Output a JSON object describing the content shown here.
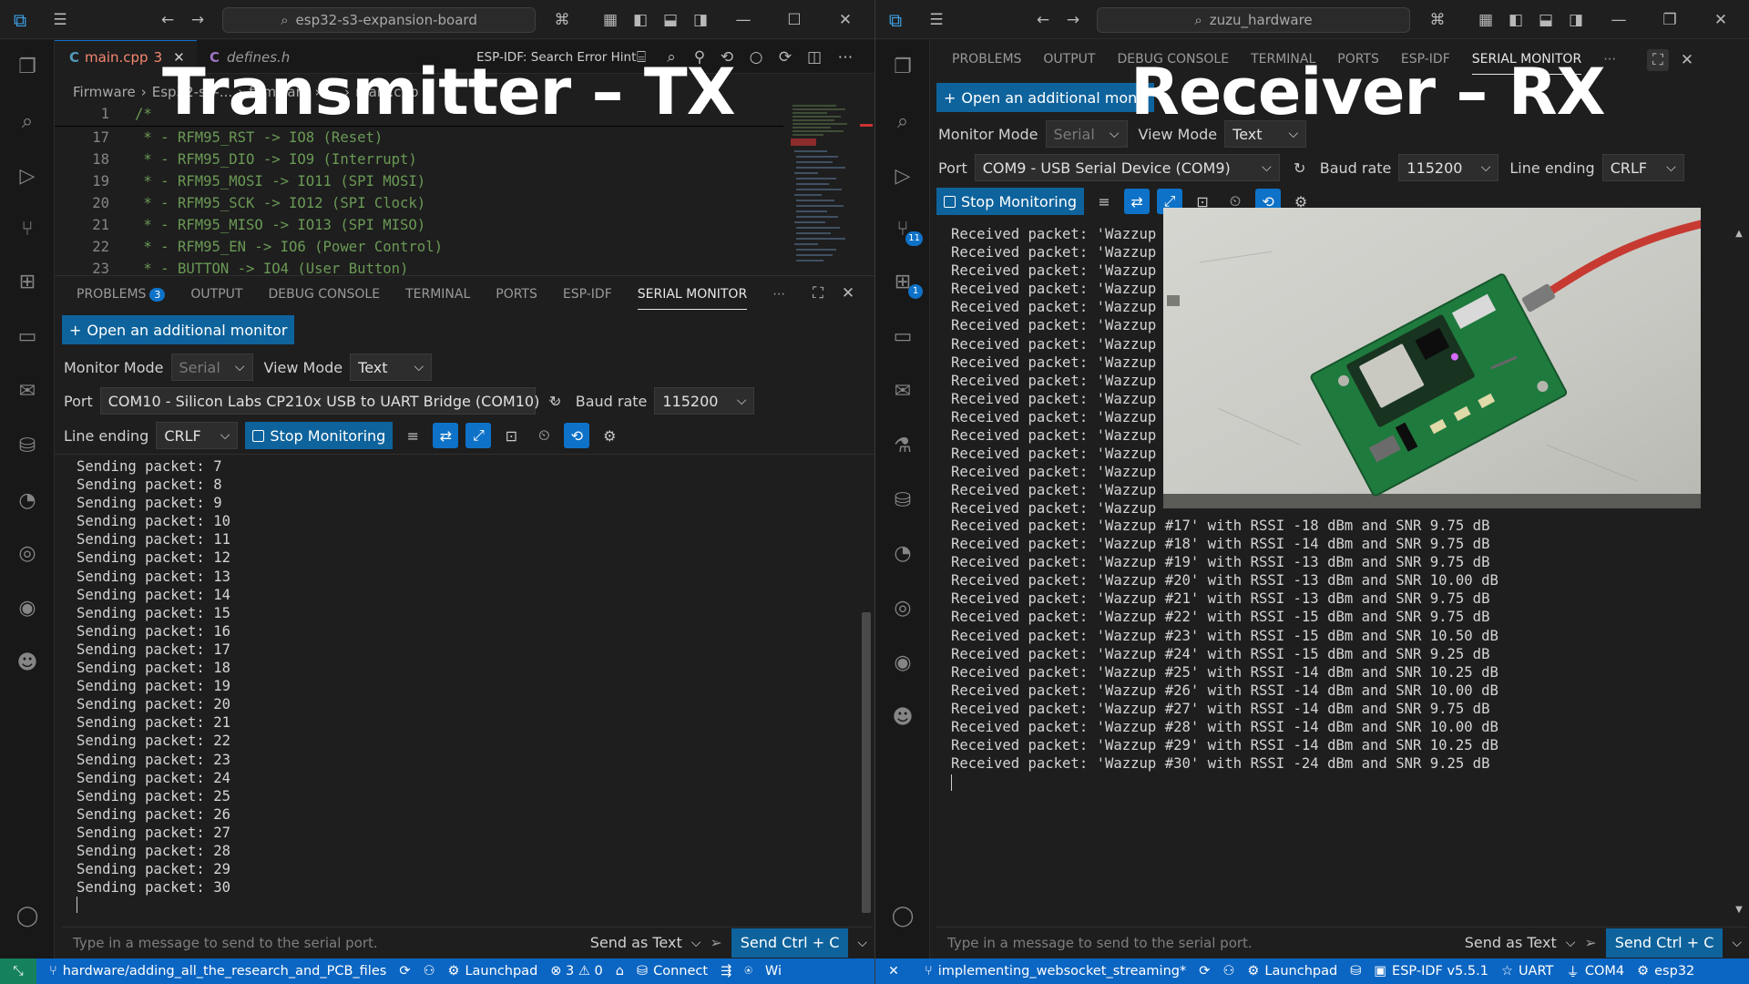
{
  "tx": {
    "search": "esp32-s3-expansion-board",
    "tabs": [
      {
        "label": "main.cpp",
        "badge": "3"
      },
      {
        "label": "defines.h"
      }
    ],
    "editor_action": "ESP-IDF: Search Error Hint",
    "breadcrumb": [
      "Firmware",
      "Esp32-s3-...",
      "firmware",
      "...",
      "main.cpp"
    ],
    "code_lines": [
      {
        "n": "1",
        "text": "/*"
      },
      {
        "n": "17",
        "text": " * - RFM95_RST -> IO8 (Reset)"
      },
      {
        "n": "18",
        "text": " * - RFM95_DIO -> IO9 (Interrupt)"
      },
      {
        "n": "19",
        "text": " * - RFM95_MOSI -> IO11 (SPI MOSI)"
      },
      {
        "n": "20",
        "text": " * - RFM95_SCK -> IO12 (SPI Clock)"
      },
      {
        "n": "21",
        "text": " * - RFM95_MISO -> IO13 (SPI MISO)"
      },
      {
        "n": "22",
        "text": " * - RFM95_EN -> IO6 (Power Control)"
      },
      {
        "n": "23",
        "text": " * - BUTTON -> IO4 (User Button)"
      }
    ],
    "panel_tabs": {
      "problems": "PROBLEMS",
      "problems_badge": "3",
      "output": "OUTPUT",
      "debug": "DEBUG CONSOLE",
      "terminal": "TERMINAL",
      "ports": "PORTS",
      "espidf": "ESP-IDF",
      "serial": "SERIAL MONITOR"
    },
    "open_monitor": "Open an additional monitor",
    "monitor_mode_label": "Monitor Mode",
    "monitor_mode": "Serial",
    "view_mode_label": "View Mode",
    "view_mode": "Text",
    "port_label": "Port",
    "port": "COM10 - Silicon Labs CP210x USB to UART Bridge (COM10)",
    "baud_label": "Baud rate",
    "baud": "115200",
    "line_ending_label": "Line ending",
    "line_ending": "CRLF",
    "stop": "Stop Monitoring",
    "output_lines": [
      "Sending packet: 7",
      "Sending packet: 8",
      "Sending packet: 9",
      "Sending packet: 10",
      "Sending packet: 11",
      "Sending packet: 12",
      "Sending packet: 13",
      "Sending packet: 14",
      "Sending packet: 15",
      "Sending packet: 16",
      "Sending packet: 17",
      "Sending packet: 18",
      "Sending packet: 19",
      "Sending packet: 20",
      "Sending packet: 21",
      "Sending packet: 22",
      "Sending packet: 23",
      "Sending packet: 24",
      "Sending packet: 25",
      "Sending packet: 26",
      "Sending packet: 27",
      "Sending packet: 28",
      "Sending packet: 29",
      "Sending packet: 30"
    ],
    "input_placeholder": "Type in a message to send to the serial port.",
    "send_as": "Send as Text",
    "send_btn": "Send Ctrl + C",
    "status": {
      "branch": "hardware/adding_all_the_research_and_PCB_files",
      "launchpad": "Launchpad",
      "problems": "⊗ 3  ⚠ 0",
      "connect": "Connect",
      "tail": "Wi"
    },
    "overlay": "Transmitter – TX"
  },
  "rx": {
    "search": "zuzu_hardware",
    "panel_tabs": {
      "problems": "PROBLEMS",
      "output": "OUTPUT",
      "debug": "DEBUG CONSOLE",
      "terminal": "TERMINAL",
      "ports": "PORTS",
      "espidf": "ESP-IDF",
      "serial": "SERIAL MONITOR"
    },
    "open_monitor": "Open an additional monit",
    "monitor_mode_label": "Monitor Mode",
    "monitor_mode": "Serial",
    "view_mode_label": "View Mode",
    "view_mode": "Text",
    "port_label": "Port",
    "port": "COM9 - USB Serial Device (COM9)",
    "baud_label": "Baud rate",
    "baud": "115200",
    "line_ending_label": "Line ending",
    "line_ending": "CRLF",
    "stop": "Stop Monitoring",
    "activity_badges": [
      "11",
      "1"
    ],
    "output_top": [
      "Received packet: 'Wazzup",
      "Received packet: 'Wazzup",
      "Received packet: 'Wazzup",
      "Received packet: 'Wazzup",
      "Received packet: 'Wazzup",
      "Received packet: 'Wazzup",
      "Received packet: 'Wazzup",
      "Received packet: 'Wazzup",
      "Received packet: 'Wazzup",
      "Received packet: 'Wazzup",
      "Received packet: 'Wazzup",
      "Received packet: 'Wazzup",
      "Received packet: 'Wazzup",
      "Received packet: 'Wazzup",
      "Received packet: 'Wazzup",
      "Received packet: 'Wazzup"
    ],
    "output_lines": [
      "Received packet: 'Wazzup #17' with RSSI -18 dBm and SNR 9.75 dB",
      "Received packet: 'Wazzup #18' with RSSI -14 dBm and SNR 9.75 dB",
      "Received packet: 'Wazzup #19' with RSSI -13 dBm and SNR 9.75 dB",
      "Received packet: 'Wazzup #20' with RSSI -13 dBm and SNR 10.00 dB",
      "Received packet: 'Wazzup #21' with RSSI -13 dBm and SNR 9.75 dB",
      "Received packet: 'Wazzup #22' with RSSI -15 dBm and SNR 9.75 dB",
      "Received packet: 'Wazzup #23' with RSSI -15 dBm and SNR 10.50 dB",
      "Received packet: 'Wazzup #24' with RSSI -15 dBm and SNR 9.25 dB",
      "Received packet: 'Wazzup #25' with RSSI -14 dBm and SNR 10.25 dB",
      "Received packet: 'Wazzup #26' with RSSI -14 dBm and SNR 10.00 dB",
      "Received packet: 'Wazzup #27' with RSSI -14 dBm and SNR 9.75 dB",
      "Received packet: 'Wazzup #28' with RSSI -14 dBm and SNR 10.00 dB",
      "Received packet: 'Wazzup #29' with RSSI -14 dBm and SNR 10.25 dB",
      "Received packet: 'Wazzup #30' with RSSI -24 dBm and SNR 9.25 dB"
    ],
    "input_placeholder": "Type in a message to send to the serial port.",
    "send_as": "Send as Text",
    "send_btn": "Send Ctrl + C",
    "status": {
      "branch": "implementing_websocket_streaming*",
      "launchpad": "Launchpad",
      "espidf": "ESP-IDF v5.5.1",
      "uart": "UART",
      "com": "COM4",
      "target": "esp32"
    },
    "overlay": "Receiver – RX"
  },
  "colors": {
    "accent": "#0e639c",
    "status": "#0b65c2",
    "remote": "#16825d",
    "pcb": "#1f7a3e"
  }
}
